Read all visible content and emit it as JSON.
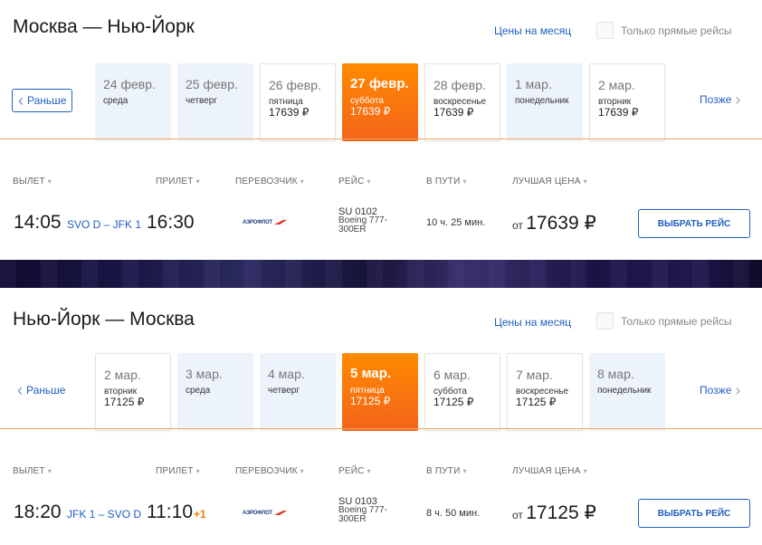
{
  "outbound": {
    "title": "Москва — Нью-Йорк",
    "month_prices_link": "Цены на месяц",
    "direct_only_label": "Только прямые рейсы",
    "earlier_label": "Раньше",
    "later_label": "Позже",
    "dates": [
      {
        "date": "24 февр.",
        "day": "среда",
        "price": ""
      },
      {
        "date": "25 февр.",
        "day": "четверг",
        "price": ""
      },
      {
        "date": "26 февр.",
        "day": "пятница",
        "price": "17639 ₽"
      },
      {
        "date": "27 февр.",
        "day": "суббота",
        "price": "17639 ₽",
        "selected": true
      },
      {
        "date": "28 февр.",
        "day": "воскресенье",
        "price": "17639 ₽"
      },
      {
        "date": "1 мар.",
        "day": "понедельник",
        "price": ""
      },
      {
        "date": "2 мар.",
        "day": "вторник",
        "price": "17639 ₽"
      }
    ],
    "columns": {
      "departure": "ВЫЛЕТ",
      "arrival": "ПРИЛЕТ",
      "carrier": "ПЕРЕВОЗЧИК",
      "flight": "РЕЙС",
      "duration": "В ПУТИ",
      "best_price": "ЛУЧШАЯ ЦЕНА"
    },
    "flight": {
      "dep_time": "14:05",
      "airports": "SVO D – JFK 1",
      "arr_time": "16:30",
      "day_offset": "",
      "carrier_logo_text": "АЭРОФЛОТ",
      "flight_number": "SU 0102",
      "aircraft_line1": "Boeing 777-",
      "aircraft_line2": "300ER",
      "duration": "10 ч. 25 мин.",
      "price_prefix": "от",
      "price": "17639 ₽",
      "select_label": "ВЫБРАТЬ РЕЙС"
    }
  },
  "return": {
    "title": "Нью-Йорк — Москва",
    "month_prices_link": "Цены на месяц",
    "direct_only_label": "Только прямые рейсы",
    "earlier_label": "Раньше",
    "later_label": "Позже",
    "dates": [
      {
        "date": "2 мар.",
        "day": "вторник",
        "price": "17125 ₽"
      },
      {
        "date": "3 мар.",
        "day": "среда",
        "price": ""
      },
      {
        "date": "4 мар.",
        "day": "четверг",
        "price": ""
      },
      {
        "date": "5 мар.",
        "day": "пятница",
        "price": "17125 ₽",
        "selected": true
      },
      {
        "date": "6 мар.",
        "day": "суббота",
        "price": "17125 ₽"
      },
      {
        "date": "7 мар.",
        "day": "воскресенье",
        "price": "17125 ₽"
      },
      {
        "date": "8 мар.",
        "day": "понедельник",
        "price": ""
      }
    ],
    "columns": {
      "departure": "ВЫЛЕТ",
      "arrival": "ПРИЛЕТ",
      "carrier": "ПЕРЕВОЗЧИК",
      "flight": "РЕЙС",
      "duration": "В ПУТИ",
      "best_price": "ЛУЧШАЯ ЦЕНА"
    },
    "flight": {
      "dep_time": "18:20",
      "airports": "JFK 1 – SVO D",
      "arr_time": "11:10",
      "day_offset": "+1",
      "carrier_logo_text": "АЭРОФЛОТ",
      "flight_number": "SU 0103",
      "aircraft_line1": "Boeing 777-",
      "aircraft_line2": "300ER",
      "duration": "8 ч. 50 мин.",
      "price_prefix": "от",
      "price": "17125 ₽",
      "select_label": "ВЫБРАТЬ РЕЙС"
    }
  },
  "colors": {
    "accent_blue": "#1f5fc0",
    "selected_orange": "#f4641b",
    "date_bg": "#edf3fb"
  }
}
